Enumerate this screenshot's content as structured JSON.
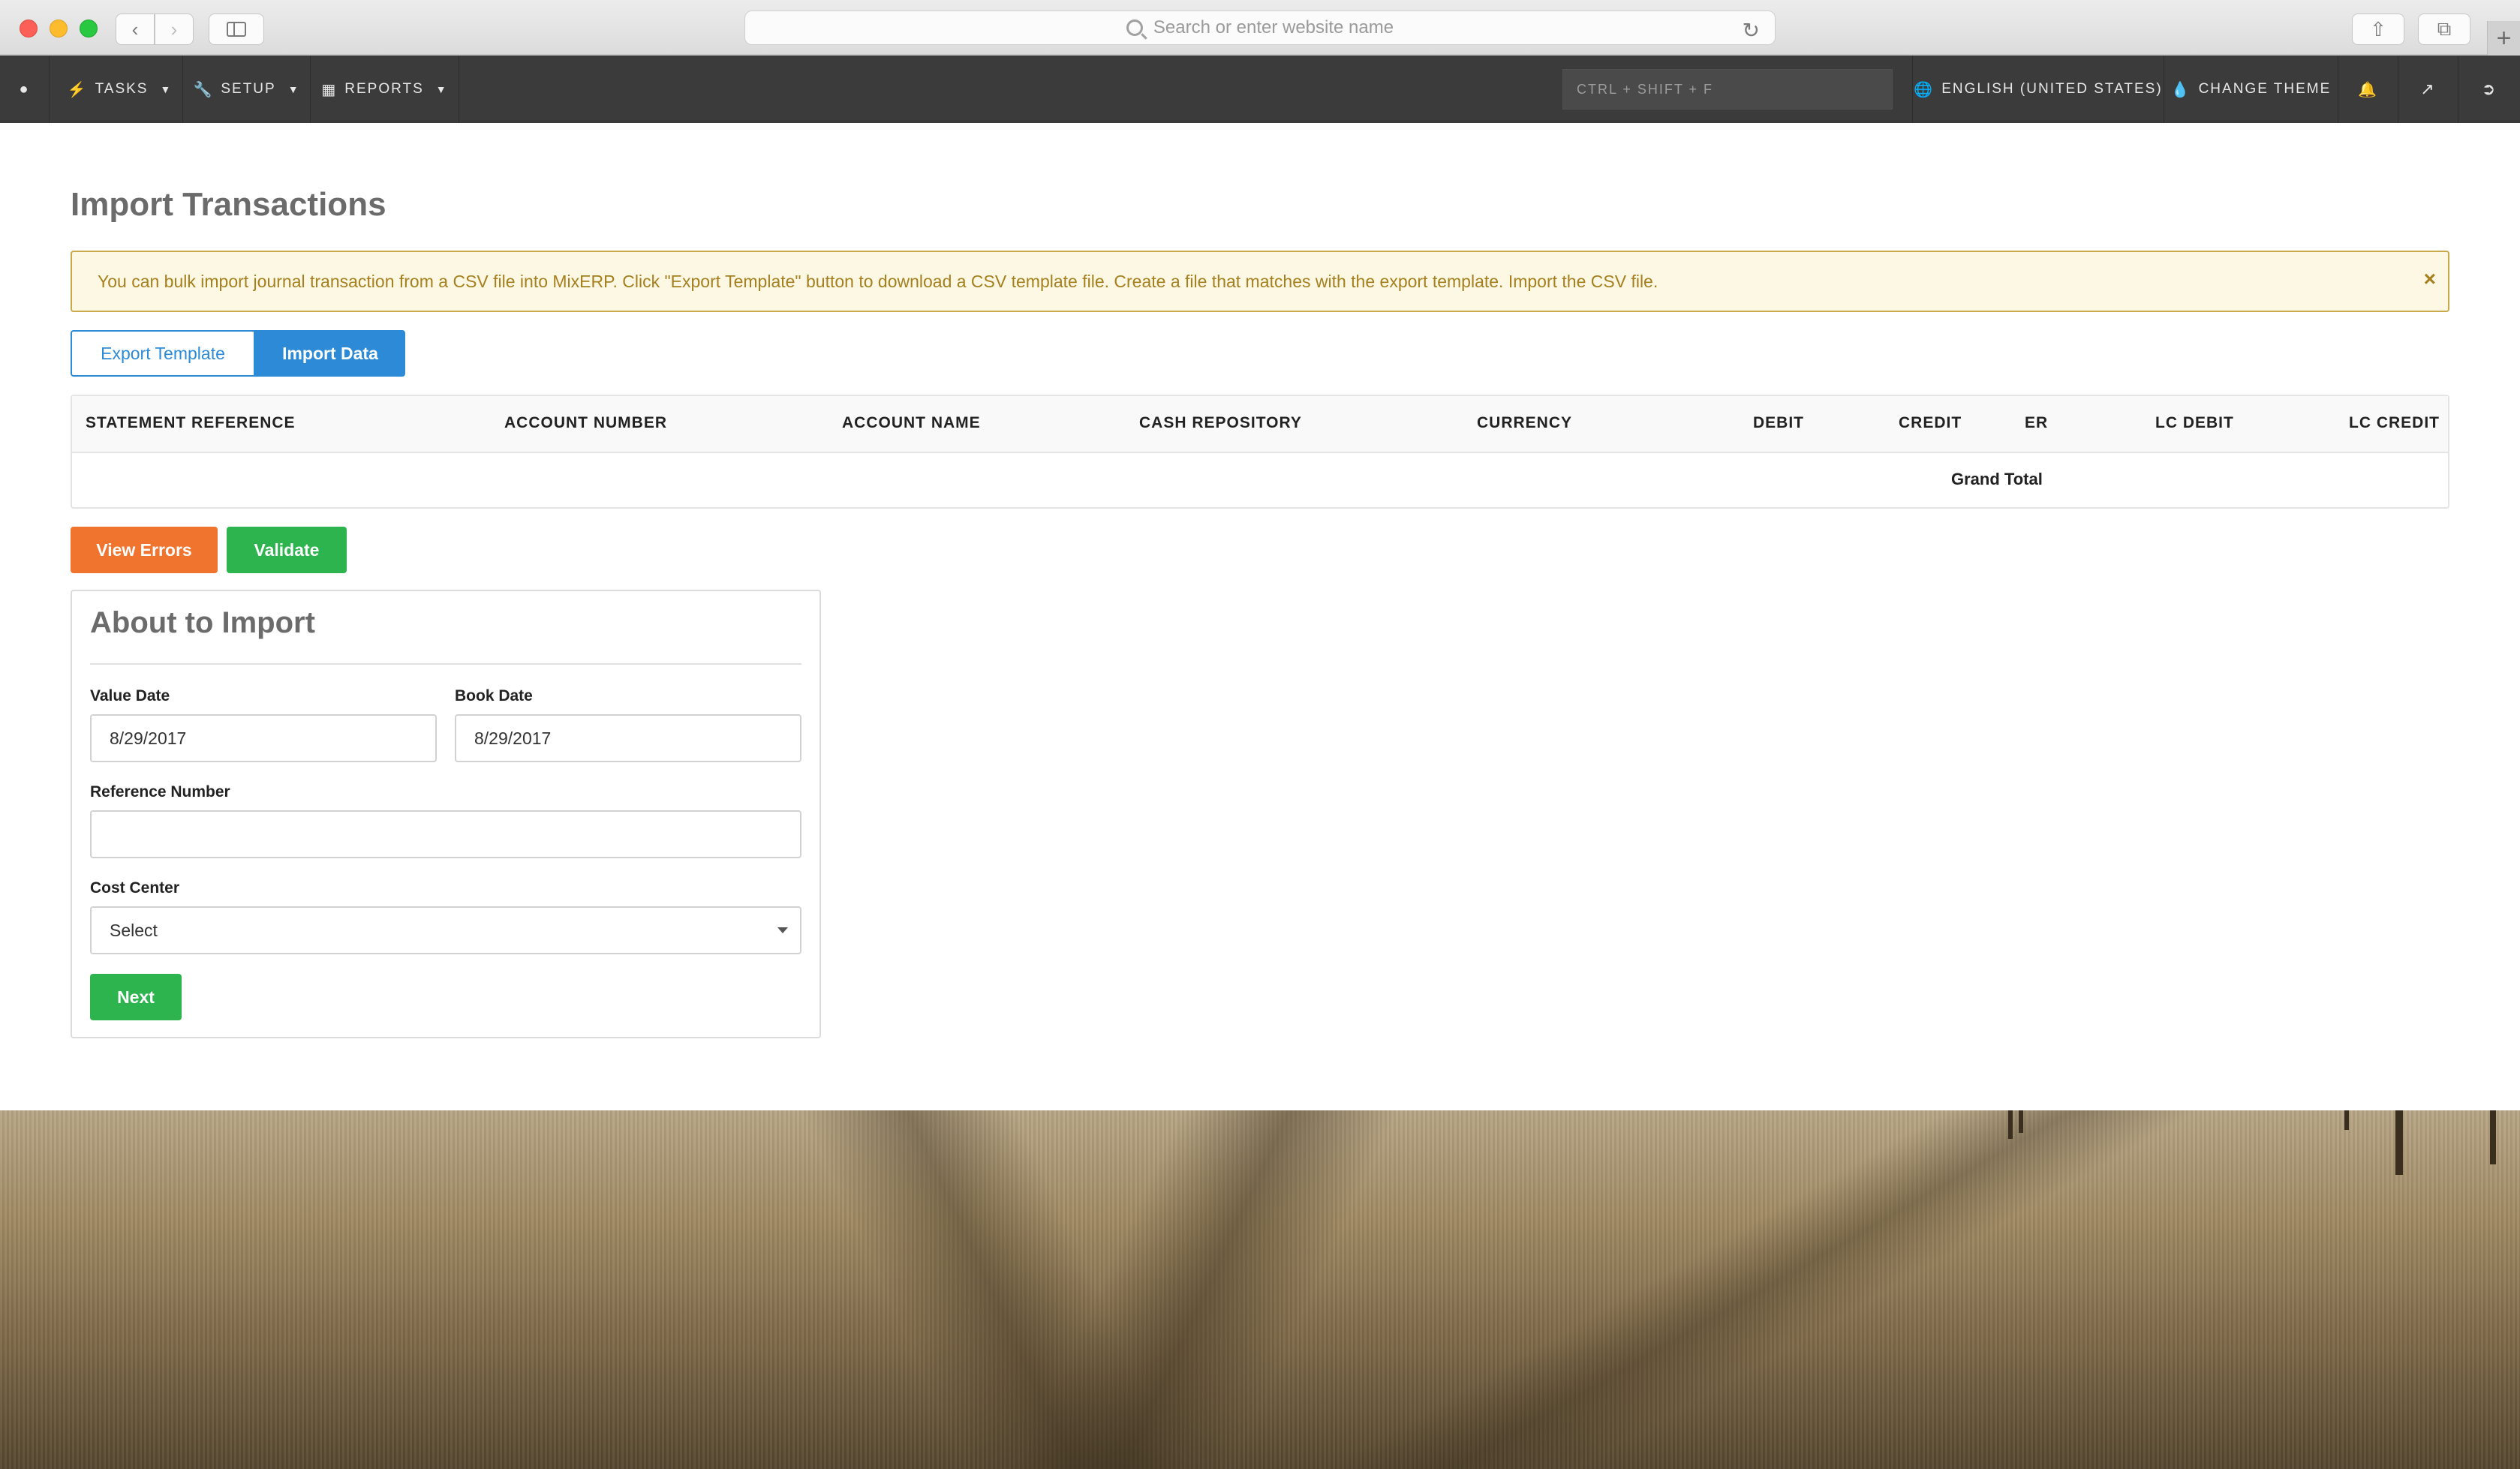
{
  "browser": {
    "address_placeholder": "Search or enter website name",
    "new_tab": "+"
  },
  "nav": {
    "tasks": "TASKS",
    "setup": "SETUP",
    "reports": "REPORTS",
    "search_placeholder": "CTRL + SHIFT + F",
    "language": "ENGLISH (UNITED STATES)",
    "change_theme": "CHANGE THEME"
  },
  "page": {
    "title": "Import Transactions",
    "alert": "You can bulk import journal transaction from a CSV file into MixERP. Click \"Export Template\" button to download a CSV template file. Create a file that matches with the export template. Import the CSV file.",
    "alert_close": "×"
  },
  "actions": {
    "export_template": "Export Template",
    "import_data": "Import Data",
    "view_errors": "View Errors",
    "validate": "Validate"
  },
  "grid": {
    "columns": [
      "STATEMENT REFERENCE",
      "ACCOUNT NUMBER",
      "ACCOUNT NAME",
      "CASH REPOSITORY",
      "CURRENCY",
      "DEBIT",
      "CREDIT",
      "ER",
      "LC DEBIT",
      "LC CREDIT"
    ],
    "grand_total_label": "Grand Total"
  },
  "form": {
    "title": "About to Import",
    "value_date_label": "Value Date",
    "value_date": "8/29/2017",
    "book_date_label": "Book Date",
    "book_date": "8/29/2017",
    "reference_number_label": "Reference Number",
    "reference_number": "",
    "cost_center_label": "Cost Center",
    "cost_center_selected": "Select",
    "next": "Next"
  },
  "colors": {
    "navbar": "#3b3b3b",
    "primary": "#2d8ad6",
    "success": "#2db44f",
    "warning_button": "#f0732e",
    "alert_bg": "#fcf8e3",
    "alert_text": "#a67f1e"
  }
}
